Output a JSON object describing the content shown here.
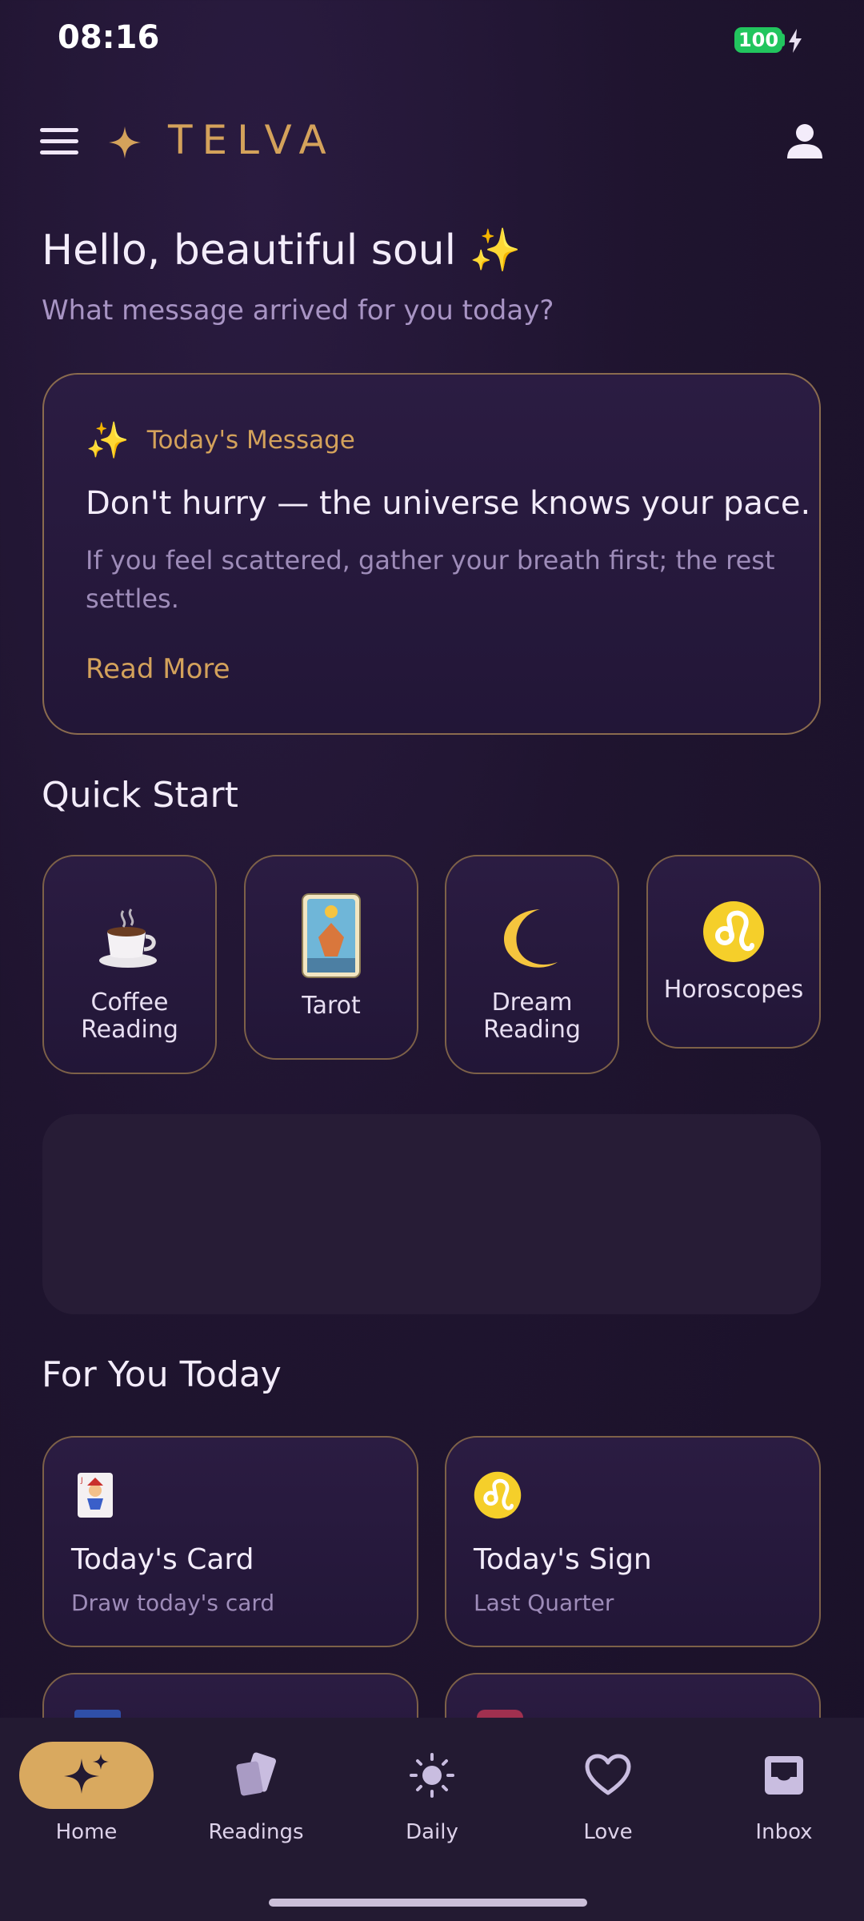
{
  "status_bar": {
    "time": "08:16",
    "battery_level": "100"
  },
  "app_bar": {
    "title": "TELVA"
  },
  "greeting": {
    "title": "Hello, beautiful soul ✨",
    "subtitle": "What message arrived for you today?"
  },
  "message_card": {
    "label": "Today's Message",
    "title": "Don't hurry — the universe knows your pace.",
    "body": "If you feel scattered, gather your breath first; the rest settles.",
    "read_more": "Read More"
  },
  "quick_start": {
    "title": "Quick Start",
    "items": [
      {
        "label": "Coffee\nReading",
        "icon": "coffee-icon"
      },
      {
        "label": "Tarot",
        "icon": "tarot-card-icon"
      },
      {
        "label": "Dream\nReading",
        "icon": "crescent-moon-icon"
      },
      {
        "label": "Horoscopes",
        "icon": "leo-sign-icon"
      }
    ]
  },
  "for_you": {
    "title": "For You Today",
    "cards": [
      {
        "title": "Today's Card",
        "subtitle": "Draw today's card",
        "icon": "joker-card-icon"
      },
      {
        "title": "Today's Sign",
        "subtitle": "Last Quarter",
        "icon": "leo-sign-icon"
      }
    ]
  },
  "bottom_nav": {
    "items": [
      {
        "label": "Home",
        "icon": "sparkles-icon",
        "active": true
      },
      {
        "label": "Readings",
        "icon": "cards-icon",
        "active": false
      },
      {
        "label": "Daily",
        "icon": "sun-icon",
        "active": false
      },
      {
        "label": "Love",
        "icon": "heart-icon",
        "active": false
      },
      {
        "label": "Inbox",
        "icon": "inbox-icon",
        "active": false
      }
    ]
  },
  "colors": {
    "background": "#1f142f",
    "accent_gold": "#d4a25b",
    "card_border": "#8a6b4e",
    "nav_active_pill": "#d9a95f",
    "muted_text": "#9e8cb9",
    "battery_green": "#22c55e"
  }
}
